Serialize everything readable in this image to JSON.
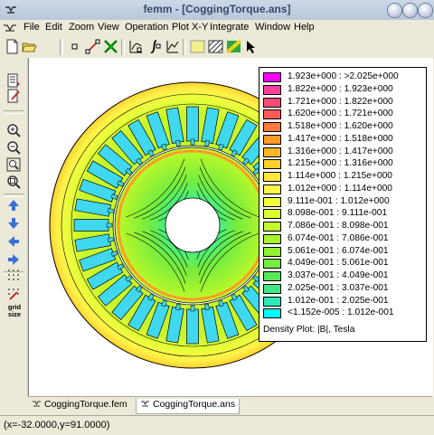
{
  "window": {
    "title": "femm - [CoggingTorque.ans]"
  },
  "menu": [
    "File",
    "Edit",
    "Zoom",
    "View",
    "Operation",
    "Plot X-Y",
    "Integrate",
    "Window",
    "Help"
  ],
  "legend": {
    "rows": [
      {
        "label": "1.923e+000 : >2.025e+000",
        "color": "#ff00ff"
      },
      {
        "label": "1.822e+000 : 1.923e+000",
        "color": "#ff3f9c"
      },
      {
        "label": "1.721e+000 : 1.822e+000",
        "color": "#ff4a7a"
      },
      {
        "label": "1.620e+000 : 1.721e+000",
        "color": "#ff5d55"
      },
      {
        "label": "1.518e+000 : 1.620e+000",
        "color": "#ff7a3c"
      },
      {
        "label": "1.417e+000 : 1.518e+000",
        "color": "#ff9b28"
      },
      {
        "label": "1.316e+000 : 1.417e+000",
        "color": "#ffb824"
      },
      {
        "label": "1.215e+000 : 1.316e+000",
        "color": "#ffd02a"
      },
      {
        "label": "1.114e+000 : 1.215e+000",
        "color": "#ffe63a"
      },
      {
        "label": "1.012e+000 : 1.114e+000",
        "color": "#fff64a"
      },
      {
        "label": "9.111e-001 : 1.012e+000",
        "color": "#f3ff3c"
      },
      {
        "label": "8.098e-001 : 9.111e-001",
        "color": "#dcff30"
      },
      {
        "label": "7.086e-001 : 8.098e-001",
        "color": "#c2fc2c"
      },
      {
        "label": "6.074e-001 : 7.086e-001",
        "color": "#a8f52e"
      },
      {
        "label": "5.061e-001 : 6.074e-001",
        "color": "#8ef232"
      },
      {
        "label": "4.049e-001 : 5.061e-001",
        "color": "#72ec40"
      },
      {
        "label": "3.037e-001 : 4.049e-001",
        "color": "#58e85a"
      },
      {
        "label": "2.025e-001 : 3.037e-001",
        "color": "#40e685"
      },
      {
        "label": "1.012e-001 : 2.025e-001",
        "color": "#2ee8b8"
      },
      {
        "label": "<1.152e-005 : 1.012e-001",
        "color": "#00ffff"
      }
    ],
    "title": "Density Plot: |B|, Tesla"
  },
  "tabs": [
    {
      "label": "CoggingTorque.fem",
      "active": false
    },
    {
      "label": "CoggingTorque.ans",
      "active": true
    }
  ],
  "status": "(x=-32.0000,y=91.0000)",
  "left_toolbar": {
    "grid_label_1": "grid",
    "grid_label_2": "size"
  },
  "icons": [
    "new-file-icon",
    "open-folder-icon",
    "point-mode-icon",
    "segment-mode-icon",
    "block-mode-icon",
    "contour-icon",
    "integrate-icon",
    "zoom-in-icon",
    "zoom-out-icon",
    "zoom-window-icon",
    "pan-icon",
    "arrow-up-icon",
    "arrow-down-icon",
    "arrow-left-icon",
    "arrow-right-icon",
    "grid-icon",
    "snap-grid-icon"
  ]
}
